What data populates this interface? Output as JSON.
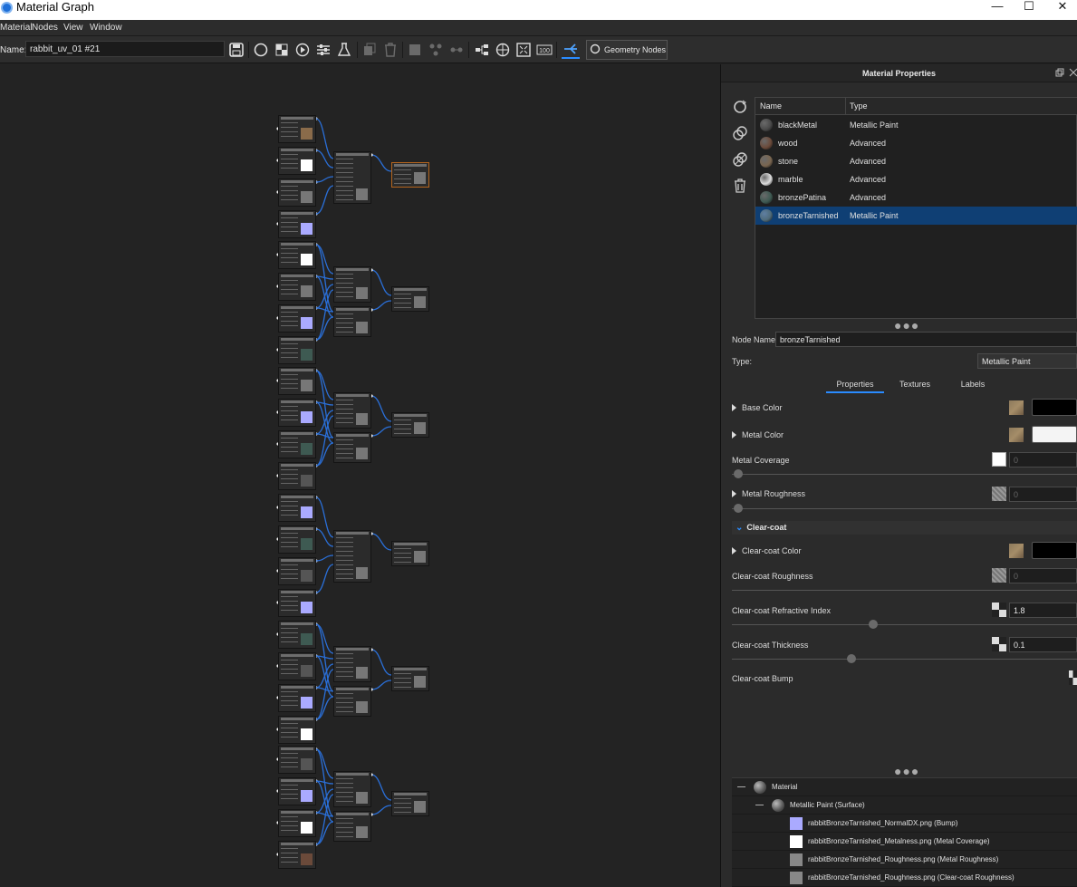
{
  "window": {
    "title": "Material Graph",
    "minimize": "—",
    "maximize": "☐",
    "close": "✕"
  },
  "menu": [
    "Material",
    "Nodes",
    "View",
    "Window"
  ],
  "toolbar": {
    "name_label": "Name:",
    "name_value": "rabbit_uv_01 #21",
    "geometry_nodes_label": "Geometry Nodes"
  },
  "panel": {
    "title": "Material Properties",
    "columns": {
      "name": "Name",
      "type": "Type"
    },
    "materials": [
      {
        "name": "blackMetal",
        "type": "Metallic Paint",
        "color": "#4a4a4a"
      },
      {
        "name": "wood",
        "type": "Advanced",
        "color": "#6b4a3a"
      },
      {
        "name": "stone",
        "type": "Advanced",
        "color": "#7a6650"
      },
      {
        "name": "marble",
        "type": "Advanced",
        "color": "#dcdcdc"
      },
      {
        "name": "bronzePatina",
        "type": "Advanced",
        "color": "#3e5a52"
      },
      {
        "name": "bronzeTarnished",
        "type": "Metallic Paint",
        "color": "#4f6b7a"
      }
    ],
    "selected_index": 5,
    "node_name_label": "Node Name:",
    "node_name_value": "bronzeTarnished",
    "type_label": "Type:",
    "type_value": "Metallic Paint",
    "tabs": [
      "Properties",
      "Textures",
      "Labels"
    ],
    "props": {
      "base_color": "Base Color",
      "metal_color": "Metal Color",
      "metal_coverage": "Metal Coverage",
      "metal_coverage_value": "0",
      "metal_roughness": "Metal Roughness",
      "metal_roughness_value": "0",
      "clearcoat_section": "Clear-coat",
      "clearcoat_color": "Clear-coat Color",
      "clearcoat_roughness": "Clear-coat Roughness",
      "clearcoat_roughness_value": "0",
      "clearcoat_ior": "Clear-coat Refractive Index",
      "clearcoat_ior_value": "1.8",
      "clearcoat_thickness": "Clear-coat Thickness",
      "clearcoat_thickness_value": "0.1",
      "clearcoat_bump": "Clear-coat Bump"
    },
    "tree": [
      {
        "label": "Material",
        "indent": 0
      },
      {
        "label": "Metallic Paint (Surface)",
        "indent": 1
      },
      {
        "label": "rabbitBronzeTarnished_NormalDX.png (Bump)",
        "indent": 2
      },
      {
        "label": "rabbitBronzeTarnished_Metalness.png (Metal Coverage)",
        "indent": 2
      },
      {
        "label": "rabbitBronzeTarnished_Roughness.png (Metal Roughness)",
        "indent": 2
      },
      {
        "label": "rabbitBronzeTarnished_Roughness.png (Clear-coat Roughness)",
        "indent": 2
      }
    ]
  },
  "colors": {
    "accent": "#2a8bff",
    "selection": "#0f3f74",
    "background": "#232323",
    "panel": "#2b2b2b"
  }
}
